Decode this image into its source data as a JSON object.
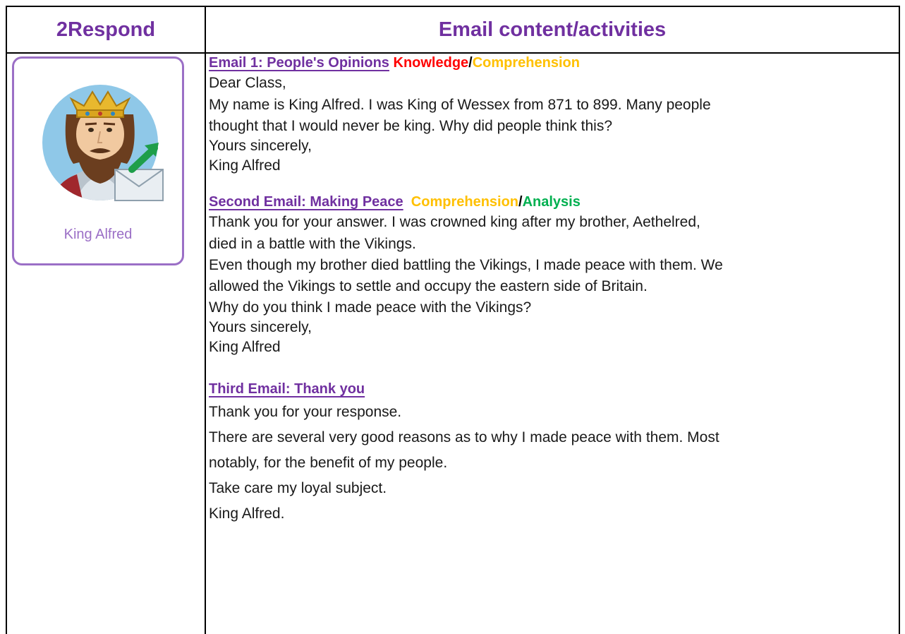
{
  "header": {
    "col1": "2Respond",
    "col2": "Email content/activities"
  },
  "card": {
    "name": "King Alfred"
  },
  "email1": {
    "title": "Email 1: People's Opinions",
    "tag1": "Knowledge",
    "slash": "/",
    "tag2": "Comprehension",
    "lines": [
      "Dear Class,",
      "My name is King Alfred. I was King of Wessex from 871 to 899. Many people",
      "thought that I would never be king. Why did people think this?",
      "Yours sincerely,",
      "King Alfred"
    ]
  },
  "email2": {
    "title": "Second Email: Making Peace",
    "tag1": "Comprehension",
    "slash": "/",
    "tag2": "Analysis",
    "lines": [
      "Thank you for your answer. I was crowned king after my brother, Aethelred,",
      "died in a battle with the Vikings.",
      "Even though my brother died battling the Vikings, I made peace with them. We",
      "allowed the Vikings to settle and occupy the eastern side of Britain.",
      "Why do you think I made peace with the Vikings?",
      "Yours sincerely,",
      "King Alfred"
    ]
  },
  "email3": {
    "title": "Third Email: Thank you",
    "lines": [
      "Thank you for your response.",
      "There are several very good reasons as to why I made peace with them. Most",
      "notably, for the benefit of my people.",
      "Take care my loyal subject.",
      "King Alfred."
    ]
  },
  "colors": {
    "purple": "#7030a0",
    "red": "#ff0000",
    "orange": "#ffc000",
    "green": "#00b050",
    "card_border": "#9b6fc6"
  },
  "icons": [
    "king-alfred-avatar-icon",
    "crown-icon",
    "envelope-send-icon"
  ]
}
